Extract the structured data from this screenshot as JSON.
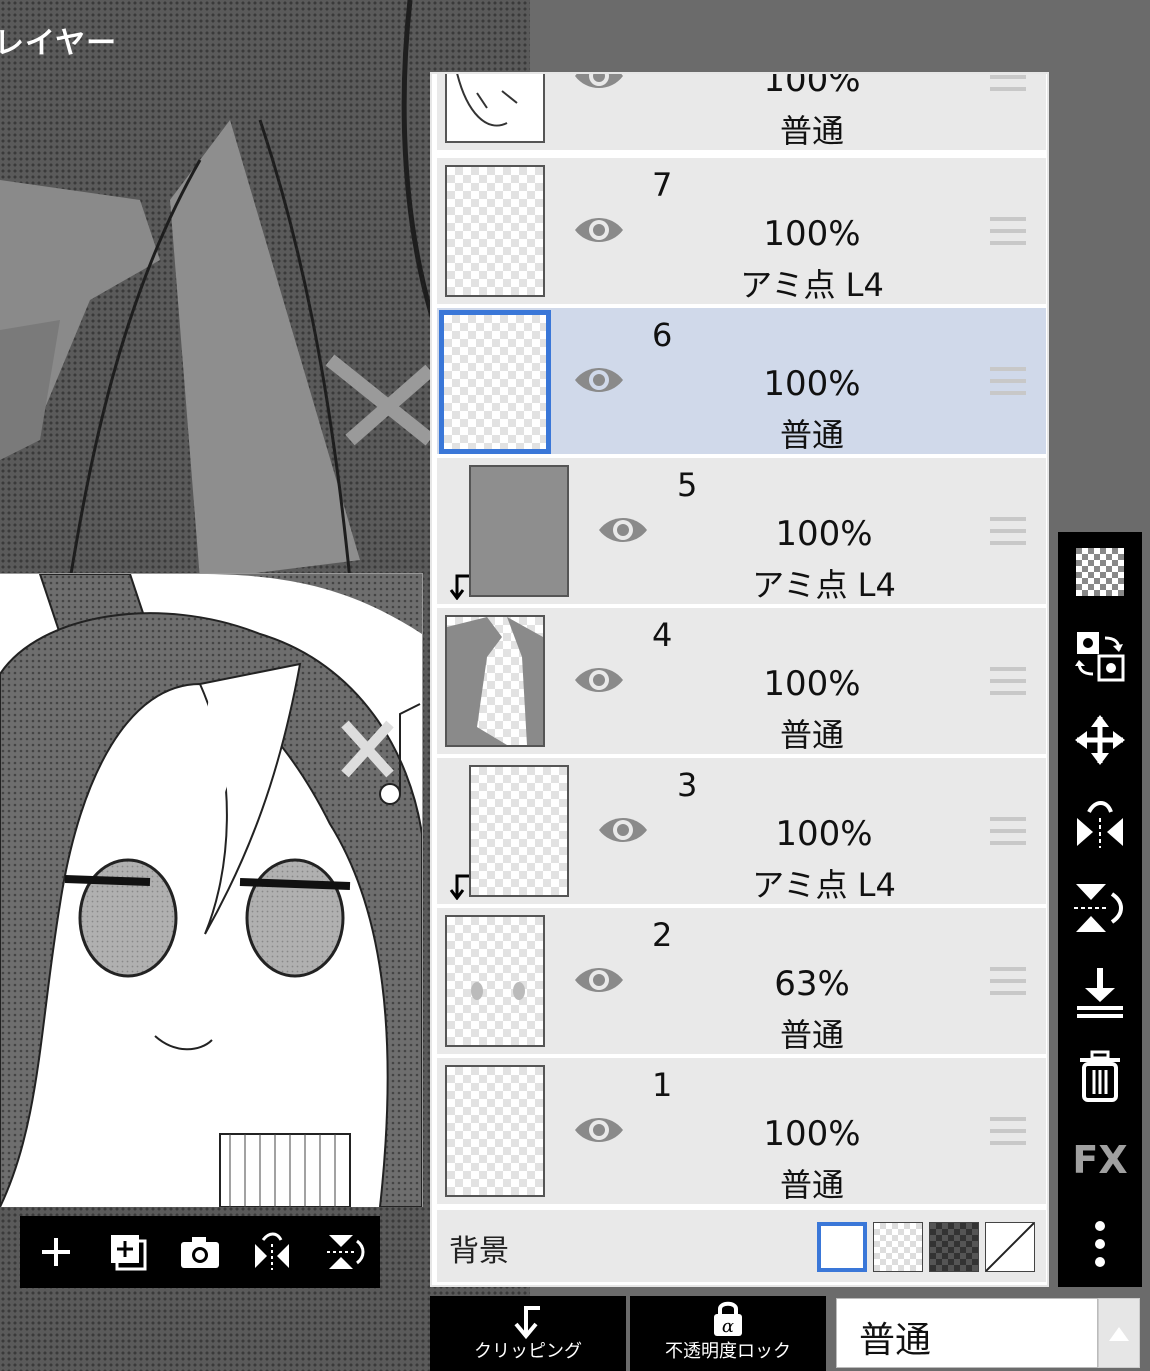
{
  "title": "レイヤー",
  "layers": [
    {
      "name": "",
      "opacity": "100%",
      "mode": "普通"
    },
    {
      "name": "7",
      "opacity": "100%",
      "mode": "アミ点 L4"
    },
    {
      "name": "6",
      "opacity": "100%",
      "mode": "普通"
    },
    {
      "name": "5",
      "opacity": "100%",
      "mode": "アミ点 L4"
    },
    {
      "name": "4",
      "opacity": "100%",
      "mode": "普通"
    },
    {
      "name": "3",
      "opacity": "100%",
      "mode": "アミ点 L4"
    },
    {
      "name": "2",
      "opacity": "63%",
      "mode": "普通"
    },
    {
      "name": "1",
      "opacity": "100%",
      "mode": "普通"
    }
  ],
  "background": {
    "label": "背景"
  },
  "bottom": {
    "clipping_label": "クリッピング",
    "alpha_lock_label": "不透明度ロック",
    "blend_mode": "普通"
  },
  "tools": {
    "fx_label": "FX"
  },
  "icons": {
    "eye": "eye-icon",
    "handle": "drag-handle-icon",
    "clip": "clipping-arrow-icon"
  },
  "colors": {
    "selected": "#d0d9ea",
    "accent": "#3a77d8"
  }
}
